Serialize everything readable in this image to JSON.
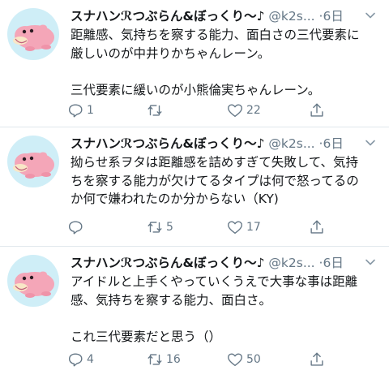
{
  "tweets": [
    {
      "display_name": "スナハンℛつぶらん&ぼっくり〜♪",
      "handle": "@k2s...",
      "dot": "·",
      "time": "6日",
      "text": "距離感、気持ちを察する能力、面白さの三代要素に\n厳しいのが中井りかちゃんレーン。\n\n三代要素に緩いのが小熊倫実ちゃんレーン。",
      "replies": "1",
      "retweets": "",
      "likes": "22"
    },
    {
      "display_name": "スナハンℛつぶらん&ぼっくり〜♪",
      "handle": "@k2s...",
      "dot": "·",
      "time": "6日",
      "text": "拗らせ系ヲタは距離感を詰めすぎて失敗して、気持\nちを察する能力が欠けてるタイプは何で怒ってるの\nか何で嫌われたのか分からない（KY)",
      "replies": "",
      "retweets": "5",
      "likes": "17"
    },
    {
      "display_name": "スナハンℛつぶらん&ぼっくり〜♪",
      "handle": "@k2s...",
      "dot": "·",
      "time": "6日",
      "text": "アイドルと上手くやっていくうえで大事な事は距離\n感、気持ちを察する能力、面白さ。\n\nこれ三代要素だと思う（）",
      "replies": "4",
      "retweets": "16",
      "likes": "50"
    }
  ],
  "icons": {
    "reply": "reply-icon",
    "retweet": "retweet-icon",
    "like": "heart-icon",
    "share": "share-icon",
    "caret": "chevron-down-icon",
    "avatar": "slowpoke-avatar"
  },
  "colors": {
    "text": "#14171a",
    "secondary": "#657786",
    "divider": "#e1e8ed",
    "avatar_bg": "#cfeef7",
    "avatar_pink": "#f4a6b8"
  }
}
